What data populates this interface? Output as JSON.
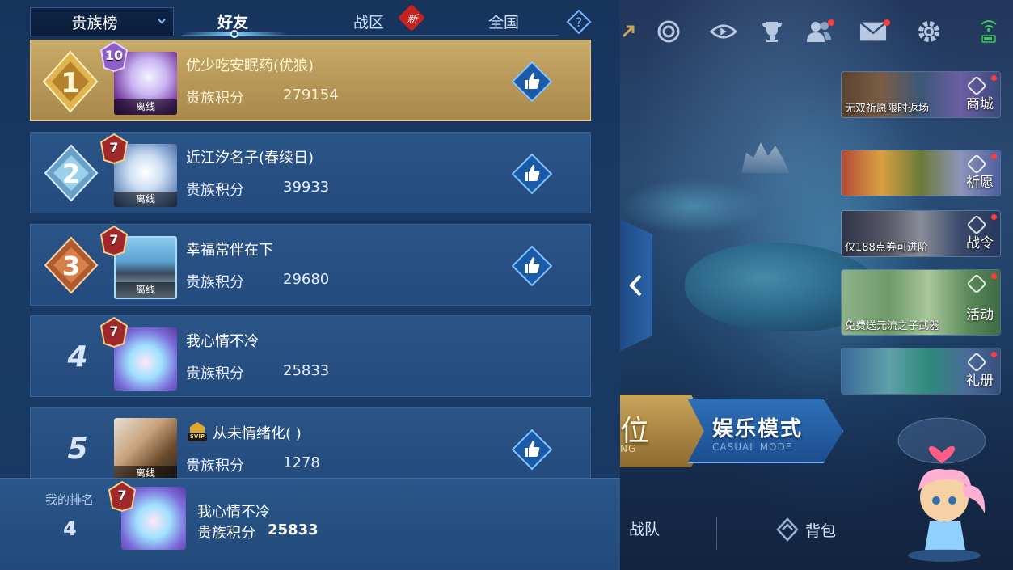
{
  "leaderboard": {
    "dropdown_label": "贵族榜",
    "tabs": [
      {
        "label": "好友",
        "active": true
      },
      {
        "label": "战区",
        "badge": "新"
      },
      {
        "label": "全国"
      }
    ],
    "help_icon": "question-diamond-icon",
    "points_label": "贵族积分",
    "offline_label": "离线",
    "rows": [
      {
        "rank": "1",
        "level": "10",
        "name": "优少吃安眠药(优狼)",
        "points": "279154",
        "offline": true,
        "like": true,
        "medal": "gold"
      },
      {
        "rank": "2",
        "level": "7",
        "name": "近江汐名子(春续日)",
        "points": "39933",
        "offline": true,
        "like": true,
        "medal": "silver"
      },
      {
        "rank": "3",
        "level": "7",
        "name": "幸福常伴在下",
        "points": "29680",
        "offline": true,
        "like": true,
        "medal": "bronze"
      },
      {
        "rank": "4",
        "level": "7",
        "name": "我心情不冷",
        "points": "25833",
        "offline": false,
        "like": false
      },
      {
        "rank": "5",
        "level": "",
        "name": "从未情绪化( )",
        "points": "1278",
        "offline": true,
        "like": true,
        "svip": "SVIP"
      }
    ],
    "my_rank": {
      "label": "我的排名",
      "rank": "4",
      "level": "7",
      "name": "我心情不冷",
      "points_label": "贵族积分",
      "points": "25833"
    }
  },
  "game": {
    "top_icons": [
      "arrow-icon",
      "spiral-icon",
      "eye-icon",
      "trophy-icon",
      "friends-icon",
      "mail-icon",
      "gear-icon",
      "wifi-battery-icon"
    ],
    "side_banners": [
      {
        "caption": "无双祈愿限时返场",
        "label": "商城"
      },
      {
        "caption": "",
        "label": "祈愿"
      },
      {
        "caption": "仅188点券可进阶",
        "label": "战令"
      },
      {
        "caption": "免费送元流之子武器",
        "label": "活动"
      },
      {
        "caption": "",
        "label": "礼册"
      }
    ],
    "mode_ranked": {
      "label": "位",
      "sub": "NG"
    },
    "mode_casual": {
      "label": "娱乐模式",
      "sub": "CASUAL MODE"
    },
    "bottom_nav": [
      {
        "label": "战队"
      },
      {
        "label": "背包"
      }
    ]
  },
  "colors": {
    "panel_bg": "#1a3a66",
    "row_bg": "#2b5487",
    "first_row_gold": "#c9ab6a",
    "accent_blue": "#7dd0ff",
    "badge_red": "#c8231f"
  }
}
